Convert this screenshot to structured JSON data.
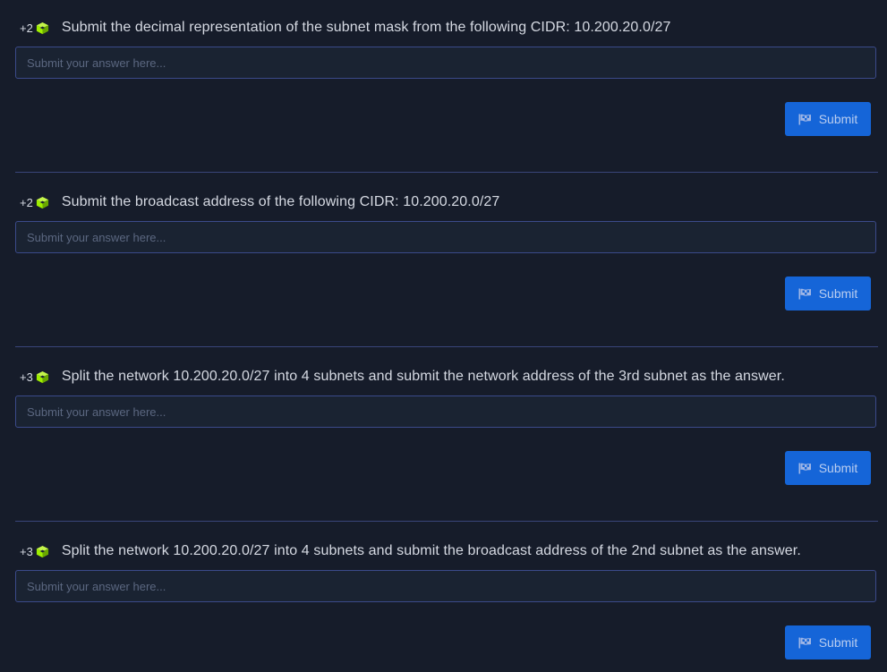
{
  "questions": [
    {
      "points": "+2",
      "text": "Submit the decimal representation of the subnet mask from the following CIDR: 10.200.20.0/27",
      "placeholder": "Submit your answer here...",
      "submit_label": "Submit"
    },
    {
      "points": "+2",
      "text": "Submit the broadcast address of the following CIDR: 10.200.20.0/27",
      "placeholder": "Submit your answer here...",
      "submit_label": "Submit"
    },
    {
      "points": "+3",
      "text": "Split the network 10.200.20.0/27 into 4 subnets and submit the network address of the 3rd subnet as the answer.",
      "placeholder": "Submit your answer here...",
      "submit_label": "Submit"
    },
    {
      "points": "+3",
      "text": "Split the network 10.200.20.0/27 into 4 subnets and submit the broadcast address of the 2nd subnet as the answer.",
      "placeholder": "Submit your answer here...",
      "submit_label": "Submit"
    }
  ],
  "icons": {
    "points": "cube-icon",
    "submit": "flag-icon"
  },
  "colors": {
    "background": "#161c2a",
    "input_background": "#1a2332",
    "input_border": "#3b4a8a",
    "submit_button": "#1565d8",
    "cube": "#9fef00",
    "divider": "#39457a"
  }
}
